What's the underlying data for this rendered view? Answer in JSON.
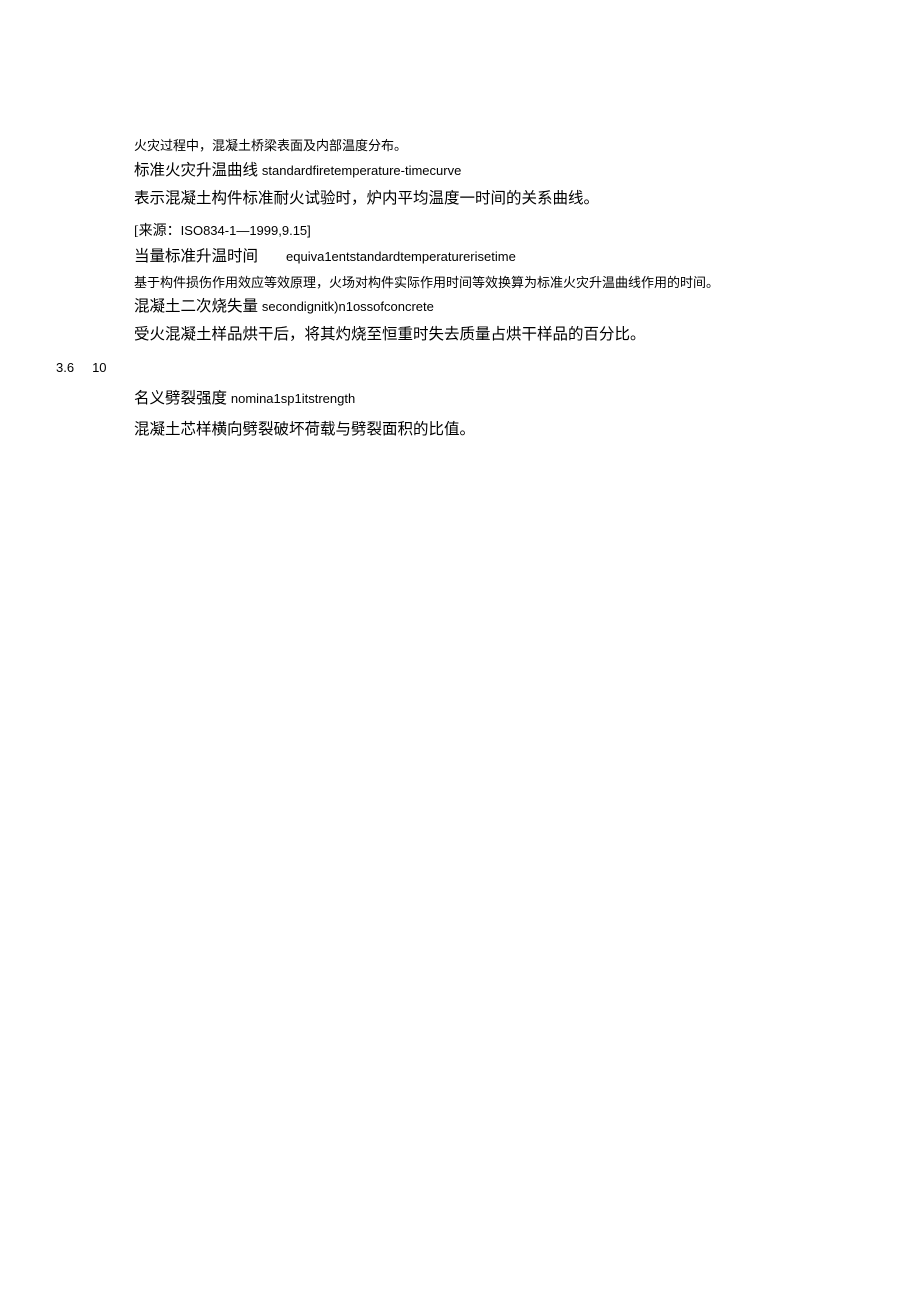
{
  "para1": "火灾过程中，混凝土桥梁表面及内部温度分布。",
  "term1_cn": "标准火灾升温曲线",
  "term1_en": "standardfiretemperature-timecurve",
  "desc1": "表示混凝土构件标准耐火试验时，炉内平均温度一时间的关系曲线。",
  "source_label": "[来源：",
  "source_code": "ISO834-1—1999,9.15]",
  "term2_cn": "当量标准升温时间",
  "term2_en": "equiva1entstandardtemperaturerisetime",
  "desc2": "基于构件损伤作用效应等效原理，火场对构件实际作用时间等效换算为标准火灾升温曲线作用的时间。",
  "term3_cn": "混凝土二次烧失量",
  "term3_en": "secondignitk)n1ossofconcrete",
  "desc3": "受火混凝土样品烘干后，将其灼烧至恒重时失去质量占烘干样品的百分比。",
  "section_num": "3.6",
  "section_sub": "10",
  "term4_cn": "名义劈裂强度",
  "term4_en": "nomina1sp1itstrength",
  "desc4": "混凝土芯样横向劈裂破坏荷载与劈裂面积的比值。"
}
